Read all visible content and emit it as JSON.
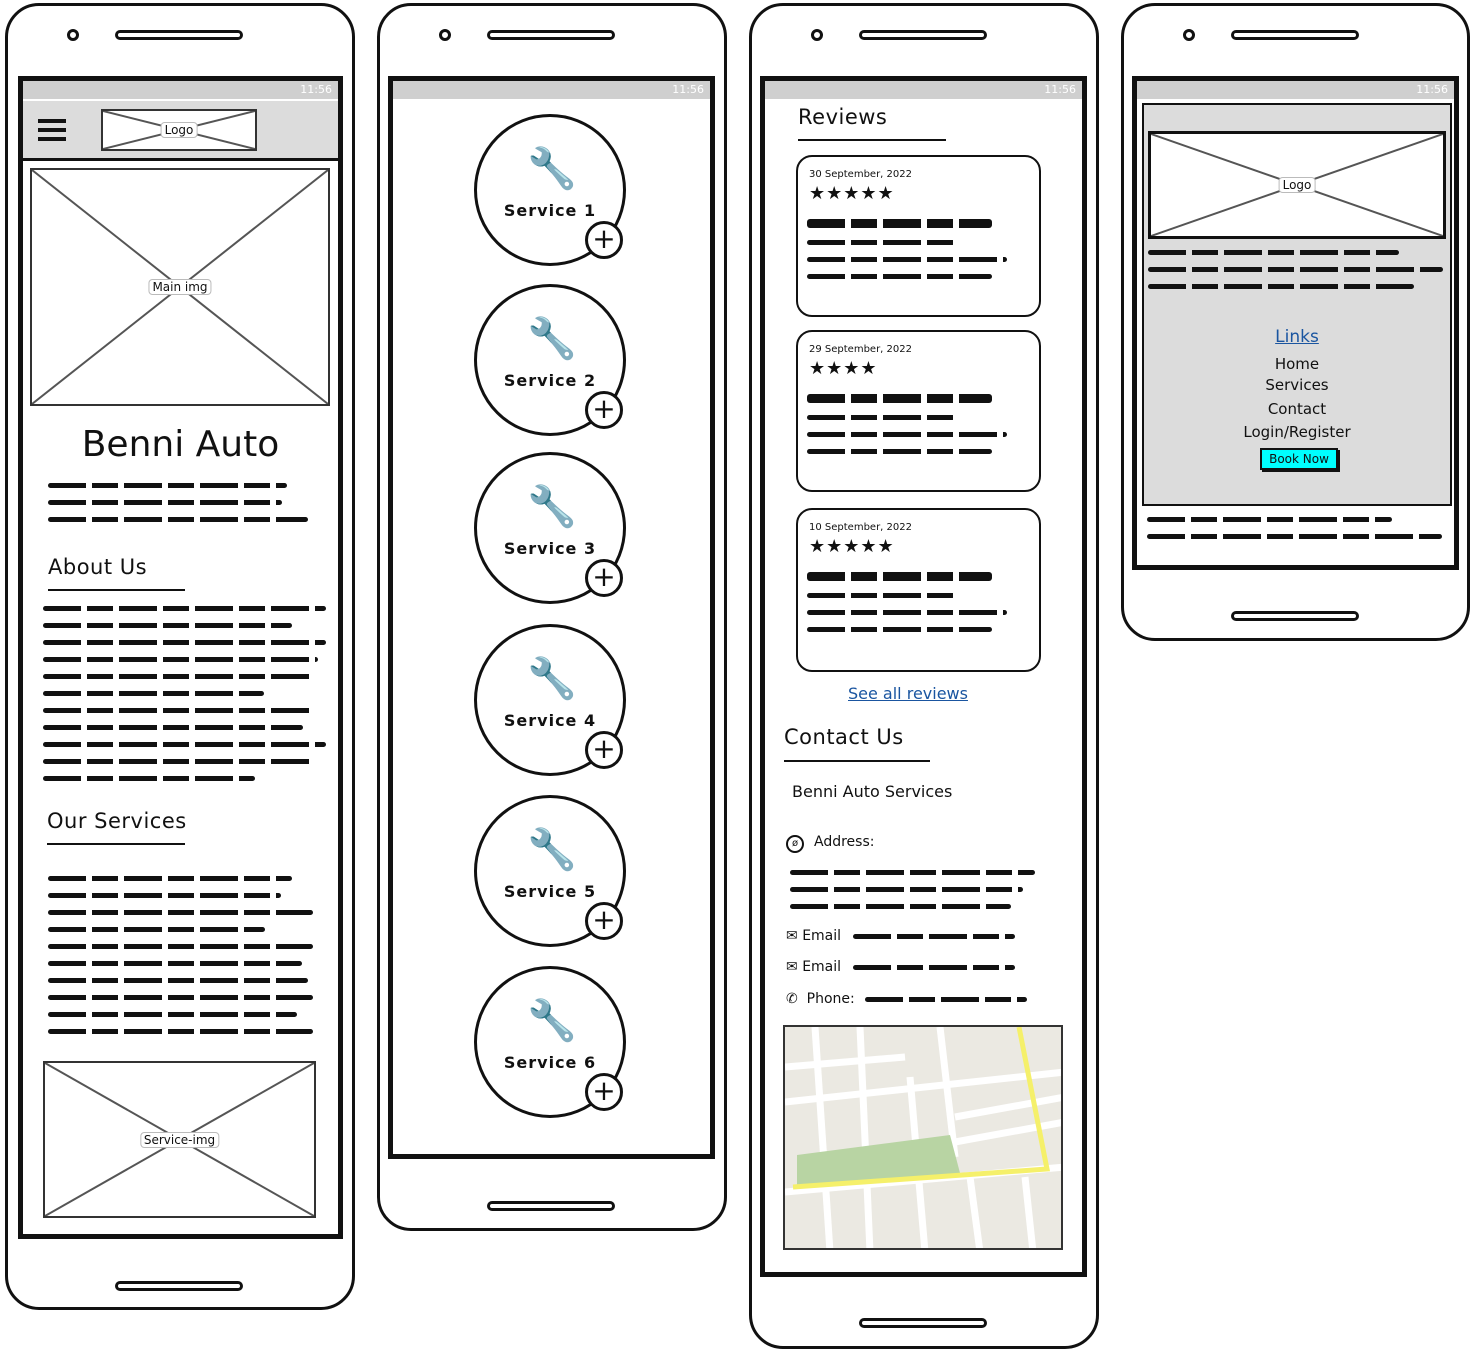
{
  "status": {
    "time": "11:56"
  },
  "home": {
    "logo": "Logo",
    "main_img": "Main img",
    "title": "Benni Auto",
    "about_heading": "About Us",
    "services_heading": "Our Services",
    "service_img": "Service-img"
  },
  "services": [
    {
      "label": "Service 1"
    },
    {
      "label": "Service 2"
    },
    {
      "label": "Service 3"
    },
    {
      "label": "Service 4"
    },
    {
      "label": "Service 5"
    },
    {
      "label": "Service 6"
    }
  ],
  "reviews": {
    "heading": "Reviews",
    "items": [
      {
        "date": "30 September, 2022",
        "stars": 5
      },
      {
        "date": "29 September, 2022",
        "stars": 4
      },
      {
        "date": "10 September, 2022",
        "stars": 5
      }
    ],
    "see_all": "See all reviews"
  },
  "contact": {
    "heading": "Contact Us",
    "company": "Benni Auto Services",
    "address_label": "Address:",
    "email1_label": "Email",
    "email2_label": "Email",
    "phone_label": "Phone:"
  },
  "menu": {
    "logo": "Logo",
    "links_heading": "Links",
    "items": [
      "Home",
      "Services",
      "Contact",
      "Login/Register"
    ],
    "book_now": "Book Now",
    "book_color": "#00ffff"
  }
}
